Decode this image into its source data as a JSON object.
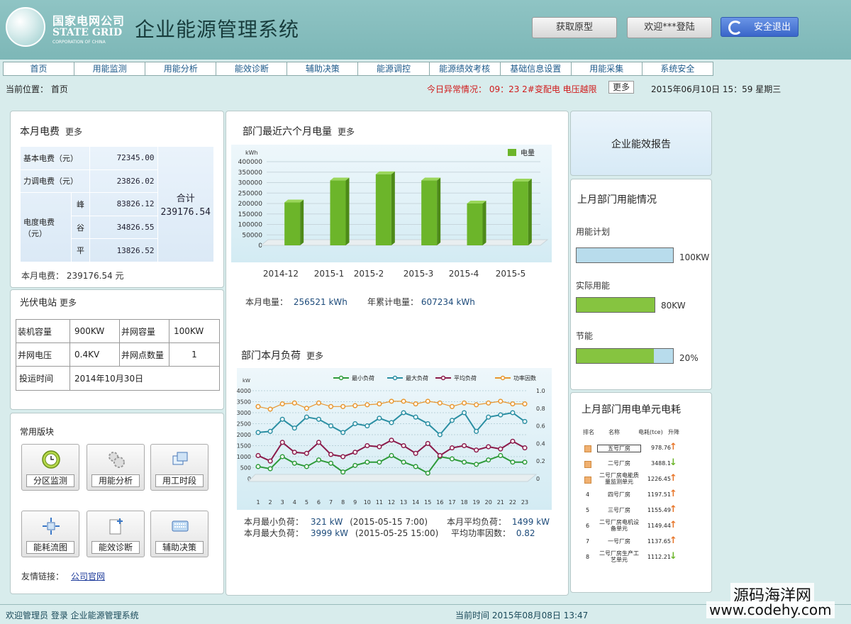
{
  "header": {
    "logo_cn": "国家电网公司",
    "logo_en": "STATE GRID",
    "logo_en_sub": "CORPORATION OF CHINA",
    "system_title": "企业能源管理系统",
    "prototype_btn": "获取原型",
    "welcome_btn": "欢迎***登陆",
    "logout_btn": "安全退出"
  },
  "nav": [
    "首页",
    "用能监测",
    "用能分析",
    "能效诊断",
    "辅助决策",
    "能源调控",
    "能源绩效考核",
    "基础信息设置",
    "用能采集",
    "系统安全"
  ],
  "statusbar": {
    "breadcrumb": "当前位置： 首页",
    "alert": "今日异常情况： 09：23  2#变配电 电压越限",
    "more": "更多",
    "datetime": "2015年06月10日   15：59  星期三"
  },
  "monthly_fee": {
    "title": "本月电费",
    "more": "更多",
    "base_label": "基本电费（元）",
    "base_value": "72345.00",
    "adjust_label": "力调电费（元）",
    "adjust_value": "23826.02",
    "elec_label": "电度电费（元）",
    "peak_label": "峰",
    "peak_value": "83826.12",
    "valley_label": "谷",
    "valley_value": "34826.55",
    "flat_label": "平",
    "flat_value": "13826.52",
    "total_label": "合计",
    "total_value": "239176.54",
    "summary": "本月电费：  239176.54 元"
  },
  "pv_station": {
    "title": "光伏电站",
    "more": "更多",
    "capacity_label": "装机容量",
    "capacity_value": "900KW",
    "grid_capacity_label": "并网容量",
    "grid_capacity_value": "100KW",
    "grid_voltage_label": "并网电压",
    "grid_voltage_value": "0.4KV",
    "grid_points_label": "并网点数量",
    "grid_points_value": "1",
    "operation_label": "投运时间",
    "operation_value": "2014年10月30日"
  },
  "shortcuts": {
    "title": "常用版块",
    "items": [
      "分区监测",
      "用能分析",
      "用工时段",
      "能耗流图",
      "能效诊断",
      "辅助决策"
    ],
    "links_label": "友情链接：",
    "link": "公司官网"
  },
  "dept_six_month": {
    "title": "部门最近六个月电量",
    "more": "更多",
    "month_usage_label": "本月电量：",
    "month_usage_value": "256521 kWh",
    "year_usage_label": "年累计电量：",
    "year_usage_value": "607234 kWh"
  },
  "dept_load": {
    "title": "部门本月负荷",
    "more": "更多",
    "min_label": "本月最小负荷：",
    "min_value": "321 kW",
    "min_time": "(2015-05-15 7:00)",
    "max_label": "本月最大负荷：",
    "max_value": "3999 kW",
    "max_time": "(2015-05-25 15:00)",
    "avg_label": "本月平均负荷：",
    "avg_value": "1499 kW",
    "pf_label": "平均功率因数：",
    "pf_value": "0.82"
  },
  "report_btn": "企业能效报告",
  "last_month_usage": {
    "title": "上月部门用能情况",
    "plan_label": "用能计划",
    "plan_value": "100KW",
    "plan_fraction": 0.0,
    "actual_label": "实际用能",
    "actual_value": "80KW",
    "actual_fraction": 1.0,
    "saving_label": "节能",
    "saving_value": "20%",
    "saving_fraction": 0.8
  },
  "unit_consumption": {
    "title": "上月部门用电单元电耗",
    "headers": [
      "排名",
      "名称",
      "电耗(tce)",
      "升降"
    ],
    "rows": [
      {
        "rank": "1",
        "name": "五号厂房",
        "value": "978.76",
        "trend": "up"
      },
      {
        "rank": "2",
        "name": "二号厂房",
        "value": "3488.1",
        "trend": "down"
      },
      {
        "rank": "3",
        "name": "二号厂房电能质量监测单元",
        "value": "1226.45",
        "trend": "up"
      },
      {
        "rank": "4",
        "name": "四号厂房",
        "value": "1197.51",
        "trend": "up"
      },
      {
        "rank": "5",
        "name": "三号厂房",
        "value": "1155.49",
        "trend": "up"
      },
      {
        "rank": "6",
        "name": "二号厂房电机设备单元",
        "value": "1149.44",
        "trend": "up"
      },
      {
        "rank": "7",
        "name": "一号厂房",
        "value": "1137.65",
        "trend": "up"
      },
      {
        "rank": "8",
        "name": "二号厂房生产工艺单元",
        "value": "1112.21",
        "trend": "down"
      }
    ]
  },
  "footer": {
    "welcome": "欢迎管理员 登录 企业能源管理系统",
    "time": "当前时间 2015年08月08日 13:47"
  },
  "watermark": {
    "line1": "源码海洋网",
    "line2": "www.codehy.com"
  },
  "colors": {
    "header_bg": "#7db7b7",
    "bar_green": "#6cb52a",
    "alert_red": "#d01a1a",
    "link_blue": "#1c5a8a"
  },
  "chart_data": [
    {
      "type": "bar",
      "ylabel": "kWh",
      "legend": [
        "电量"
      ],
      "legend_position": "top-right",
      "categories": [
        "2014-12",
        "2015-1",
        "2015-2",
        "2015-3",
        "2015-4",
        "2015-5"
      ],
      "series": [
        {
          "name": "电量",
          "values": [
            205000,
            310000,
            340000,
            310000,
            200000,
            305000
          ]
        }
      ],
      "ylim": [
        0,
        400000
      ],
      "yticks": [
        "0",
        "50000",
        "100000",
        "150000",
        "200000",
        "250000",
        "300000",
        "350000",
        "400000"
      ]
    },
    {
      "type": "line",
      "ylabel": "kW",
      "x": [
        "1",
        "2",
        "3",
        "4",
        "5",
        "6",
        "7",
        "8",
        "9",
        "10",
        "11",
        "12",
        "13",
        "14",
        "15",
        "16",
        "17",
        "18",
        "19",
        "20",
        "21",
        "22",
        "23"
      ],
      "ylim": [
        0,
        4000
      ],
      "yticks": [
        "0",
        "500",
        "1000",
        "1500",
        "2000",
        "2500",
        "3000",
        "3500",
        "4000"
      ],
      "y2lim": [
        0,
        1.0
      ],
      "y2ticks": [
        "0",
        "0.2",
        "0.4",
        "0.6",
        "0.8",
        "1.0"
      ],
      "legend_position": "top",
      "series": [
        {
          "name": "最小负荷",
          "axis": "left",
          "color": "#2e9b3a",
          "values": [
            550,
            450,
            1000,
            700,
            550,
            850,
            700,
            300,
            600,
            750,
            750,
            1050,
            750,
            550,
            250,
            1000,
            900,
            750,
            650,
            850,
            1050,
            750,
            750
          ]
        },
        {
          "name": "最大负荷",
          "axis": "left",
          "color": "#2b8fa3",
          "values": [
            2100,
            2150,
            2700,
            2300,
            2800,
            2700,
            2400,
            2100,
            2500,
            2400,
            2750,
            2550,
            3000,
            2800,
            2500,
            2000,
            2650,
            3000,
            2150,
            2800,
            2900,
            3000,
            2600
          ]
        },
        {
          "name": "平均负荷",
          "axis": "left",
          "color": "#8b1a4a",
          "values": [
            1050,
            800,
            1650,
            1200,
            1150,
            1650,
            1100,
            1000,
            1200,
            1500,
            1450,
            1750,
            1500,
            1150,
            1600,
            1050,
            1400,
            1500,
            1300,
            1450,
            1350,
            1700,
            1400
          ]
        },
        {
          "name": "功率因数",
          "axis": "right",
          "color": "#e8962e",
          "values": [
            0.82,
            0.79,
            0.85,
            0.86,
            0.8,
            0.86,
            0.82,
            0.82,
            0.83,
            0.84,
            0.85,
            0.88,
            0.88,
            0.85,
            0.88,
            0.86,
            0.82,
            0.86,
            0.84,
            0.86,
            0.88,
            0.85,
            0.85
          ]
        }
      ]
    }
  ]
}
